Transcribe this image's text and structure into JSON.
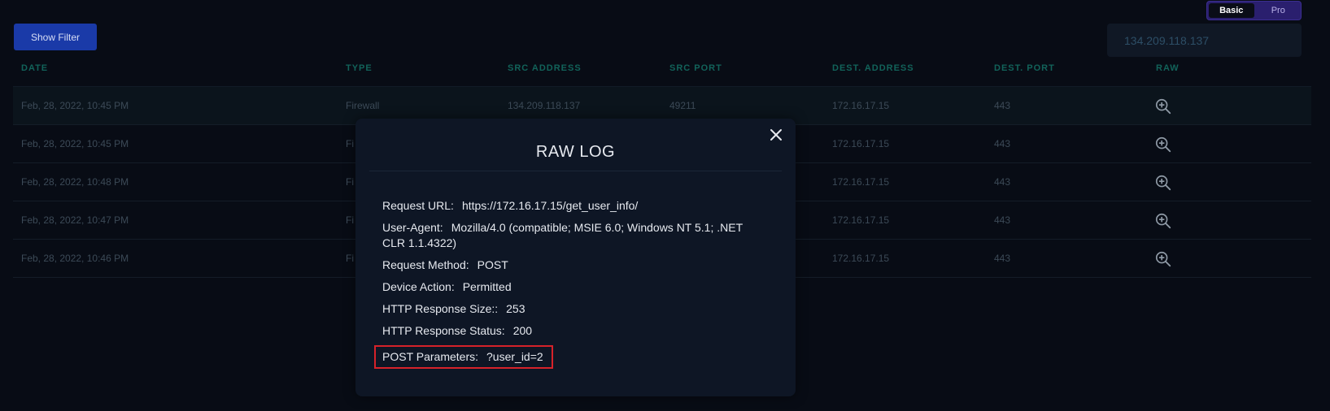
{
  "mode_toggle": {
    "basic": "Basic",
    "pro": "Pro"
  },
  "show_filter_label": "Show Filter",
  "ip_filter_value": "134.209.118.137",
  "table": {
    "headers": [
      "DATE",
      "TYPE",
      "SRC ADDRESS",
      "SRC PORT",
      "DEST. ADDRESS",
      "DEST. PORT",
      "RAW"
    ],
    "rows": [
      {
        "date": "Feb, 28, 2022, 10:45 PM",
        "type": "Firewall",
        "src": "134.209.118.137",
        "port": "49211",
        "dest": "172.16.17.15",
        "dport": "443"
      },
      {
        "date": "Feb, 28, 2022, 10:45 PM",
        "type": "Fi",
        "src": "",
        "port": "",
        "dest": "172.16.17.15",
        "dport": "443"
      },
      {
        "date": "Feb, 28, 2022, 10:48 PM",
        "type": "Fi",
        "src": "",
        "port": "",
        "dest": "172.16.17.15",
        "dport": "443"
      },
      {
        "date": "Feb, 28, 2022, 10:47 PM",
        "type": "Fi",
        "src": "",
        "port": "",
        "dest": "172.16.17.15",
        "dport": "443"
      },
      {
        "date": "Feb, 28, 2022, 10:46 PM",
        "type": "Fi",
        "src": "",
        "port": "",
        "dest": "172.16.17.15",
        "dport": "443"
      }
    ]
  },
  "modal": {
    "title": "RAW LOG",
    "items": [
      {
        "key": "Request URL:",
        "value": "https://172.16.17.15/get_user_info/"
      },
      {
        "key": "User-Agent:",
        "value": "Mozilla/4.0 (compatible; MSIE 6.0; Windows NT 5.1; .NET CLR 1.1.4322)"
      },
      {
        "key": "Request Method:",
        "value": "POST"
      },
      {
        "key": "Device Action:",
        "value": "Permitted"
      },
      {
        "key": "HTTP Response Size::",
        "value": "253"
      },
      {
        "key": "HTTP Response Status:",
        "value": "200"
      },
      {
        "key": "POST Parameters:",
        "value": "?user_id=2"
      }
    ]
  },
  "colors": {
    "background": "#080c15",
    "accent_button": "#1a3aa8",
    "header_text": "#12635a",
    "highlight_border": "#d6222a",
    "toggle": "#2a1f6e"
  },
  "icons": {
    "raw": "zoom-in-icon",
    "close": "close-icon"
  }
}
